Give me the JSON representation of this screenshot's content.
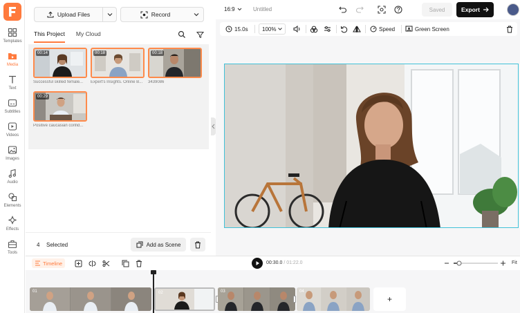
{
  "rail": {
    "items": [
      {
        "label": "Templates",
        "icon": "templates-icon"
      },
      {
        "label": "Media",
        "icon": "media-icon",
        "active": true
      },
      {
        "label": "Text",
        "icon": "text-icon"
      },
      {
        "label": "Subtitles",
        "icon": "subtitles-icon"
      },
      {
        "label": "Videos",
        "icon": "videos-icon"
      },
      {
        "label": "Images",
        "icon": "images-icon"
      },
      {
        "label": "Audio",
        "icon": "audio-icon"
      },
      {
        "label": "Elements",
        "icon": "elements-icon"
      },
      {
        "label": "Effects",
        "icon": "effects-icon"
      },
      {
        "label": "Tools",
        "icon": "tools-icon"
      }
    ]
  },
  "panel": {
    "upload_label": "Upload Files",
    "record_label": "Record",
    "tabs": [
      {
        "label": "This Project",
        "active": true
      },
      {
        "label": "My Cloud",
        "active": false
      }
    ],
    "media": [
      {
        "duration": "00:14",
        "caption": "Successful skilled female..."
      },
      {
        "duration": "00:18",
        "caption": "Expert's Insights. Online B..."
      },
      {
        "duration": "00:18",
        "caption": "3439086"
      },
      {
        "duration": "00:29",
        "caption": "Positive caucasian confid..."
      }
    ],
    "selected_count": "4",
    "selected_label": "Selected",
    "add_scene_label": "Add as Scene"
  },
  "topbar": {
    "ratio": "16:9",
    "title": "Untitled",
    "saved_label": "Saved",
    "export_label": "Export"
  },
  "toolbar": {
    "duration": "15.0s",
    "zoom": "100%",
    "speed_label": "Speed",
    "green_screen_label": "Green Screen"
  },
  "timeline": {
    "tag_label": "Timeline",
    "current_time": "00:30.0",
    "total_time": "/ 01:22.0",
    "fit_label": "Fit",
    "clips": [
      {
        "num": "01"
      },
      {
        "num": "02"
      },
      {
        "num": "03"
      },
      {
        "num": "04"
      }
    ],
    "add_label": "+"
  },
  "colors": {
    "accent": "#ff7a3d",
    "canvas_border": "#3fc1d8",
    "export_bg": "#111111"
  }
}
